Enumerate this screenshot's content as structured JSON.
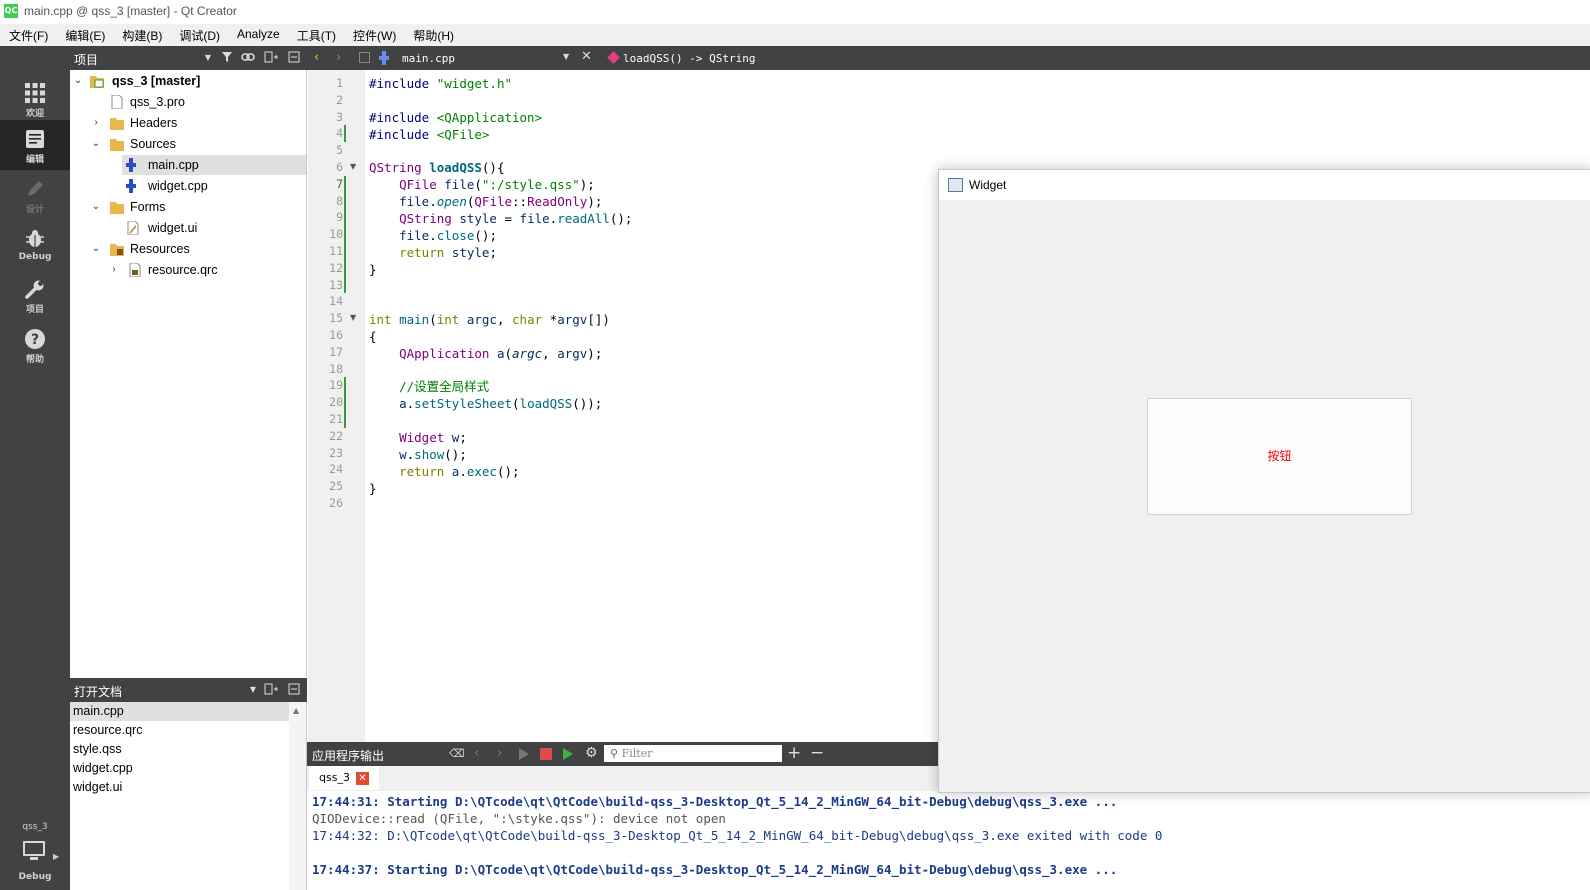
{
  "window": {
    "title": "main.cpp @ qss_3 [master] - Qt Creator",
    "logo": "QC"
  },
  "menu": [
    "文件(F)",
    "编辑(E)",
    "构建(B)",
    "调试(D)",
    "Analyze",
    "工具(T)",
    "控件(W)",
    "帮助(H)"
  ],
  "modes": [
    {
      "label": "欢迎",
      "icon": "grid-icon"
    },
    {
      "label": "编辑",
      "icon": "edit-icon"
    },
    {
      "label": "设计",
      "icon": "pencil-icon"
    },
    {
      "label": "Debug",
      "icon": "bug-icon"
    },
    {
      "label": "项目",
      "icon": "wrench-icon"
    },
    {
      "label": "帮助",
      "icon": "help-icon"
    }
  ],
  "kit": {
    "label": "qss_3",
    "sub": "Debug"
  },
  "project_pane": {
    "title": "项目",
    "tree": [
      {
        "label": "qss_3 [master]"
      },
      {
        "label": "qss_3.pro"
      },
      {
        "label": "Headers"
      },
      {
        "label": "Sources"
      },
      {
        "label": "main.cpp"
      },
      {
        "label": "widget.cpp"
      },
      {
        "label": "Forms"
      },
      {
        "label": "widget.ui"
      },
      {
        "label": "Resources"
      },
      {
        "label": "resource.qrc"
      }
    ]
  },
  "open_docs": {
    "title": "打开文档",
    "items": [
      "main.cpp",
      "resource.qrc",
      "style.qss",
      "widget.cpp",
      "widget.ui"
    ]
  },
  "editor": {
    "file": "main.cpp",
    "function": "loadQSS() -> QString",
    "line_numbers": [
      "1",
      "2",
      "3",
      "4",
      "5",
      "6",
      "7",
      "8",
      "9",
      "10",
      "11",
      "12",
      "13",
      "14",
      "15",
      "16",
      "17",
      "18",
      "19",
      "20",
      "21",
      "22",
      "23",
      "24",
      "25",
      "26"
    ],
    "current_line": 7
  },
  "output": {
    "title": "应用程序输出",
    "filter_placeholder": "Filter",
    "tab": "qss_3",
    "lines": [
      "17:44:31: Starting D:\\QTcode\\qt\\QtCode\\build-qss_3-Desktop_Qt_5_14_2_MinGW_64_bit-Debug\\debug\\qss_3.exe ...",
      "QIODevice::read (QFile, \":\\styke.qss\"): device not open",
      "17:44:32: D:\\QTcode\\qt\\QtCode\\build-qss_3-Desktop_Qt_5_14_2_MinGW_64_bit-Debug\\debug\\qss_3.exe exited with code 0",
      "",
      "17:44:37: Starting D:\\QTcode\\qt\\QtCode\\build-qss_3-Desktop_Qt_5_14_2_MinGW_64_bit-Debug\\debug\\qss_3.exe ..."
    ]
  },
  "widget_window": {
    "title": "Widget",
    "button_label": "按钮",
    "button_text_color": "#ff0000"
  }
}
